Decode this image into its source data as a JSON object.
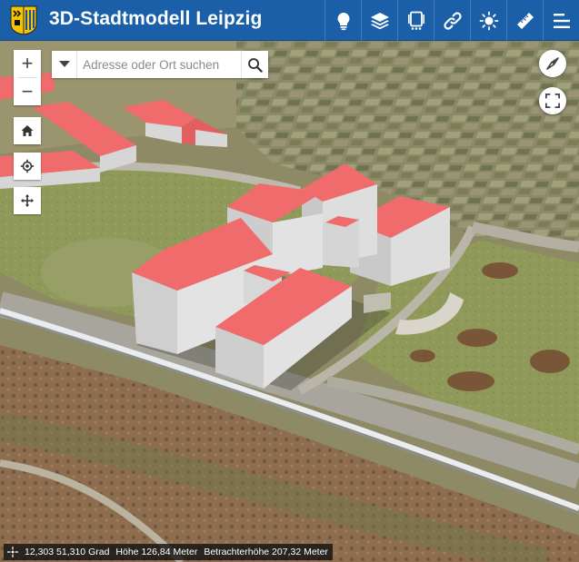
{
  "header": {
    "title": "3D-Stadtmodell Leipzig",
    "logo_icon": "leipzig-coat-of-arms-icon",
    "background": "#1a5fa8",
    "toolbar": [
      {
        "name": "legend-button",
        "icon": "lightbulb-icon"
      },
      {
        "name": "layers-button",
        "icon": "layers-icon"
      },
      {
        "name": "tools-button",
        "icon": "device-icon"
      },
      {
        "name": "share-link-button",
        "icon": "link-icon"
      },
      {
        "name": "sun-button",
        "icon": "sun-icon"
      },
      {
        "name": "measure-button",
        "icon": "ruler-icon"
      },
      {
        "name": "menu-button",
        "icon": "menu-icon"
      }
    ]
  },
  "map": {
    "zoom_in_label": "+",
    "zoom_out_label": "−",
    "search": {
      "placeholder": "Adresse oder Ort suchen",
      "value": ""
    },
    "controls": [
      "home-icon",
      "locate-icon",
      "pan-icon",
      "compass-icon",
      "fullscreen-icon"
    ],
    "roof_color": "#f06b6b",
    "wall_color": "#dcdcdc"
  },
  "status": {
    "coordinates": "12,303 51,310 Grad",
    "height": "Höhe 126,84 Meter",
    "viewer_height": "Betrachterhöhe 207,32 Meter"
  }
}
